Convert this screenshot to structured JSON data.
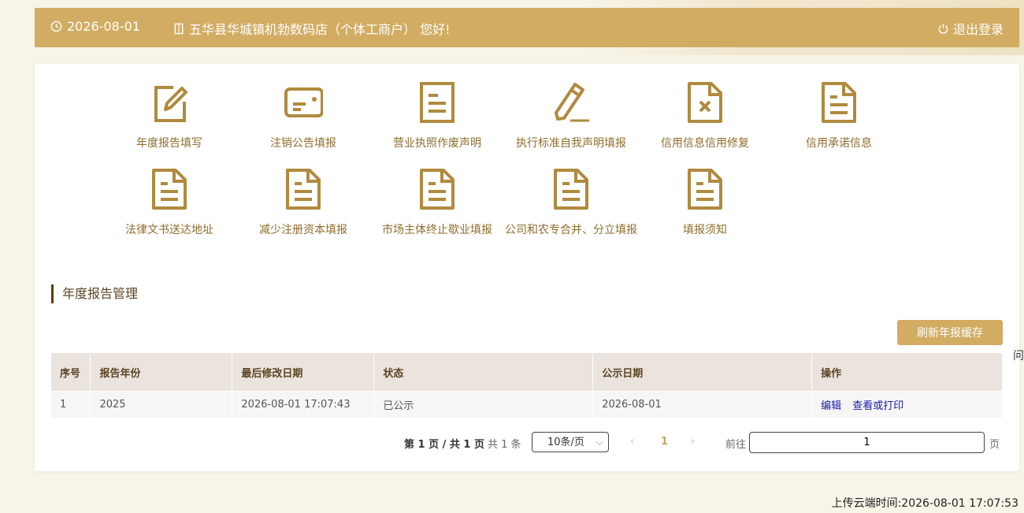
{
  "topbar": {
    "date": "2026-08-01",
    "greeting": "五华县华城镇机勃数码店（个体工商户） 您好!",
    "logout_label": "退出登录"
  },
  "menu": [
    {
      "label": "年度报告填写",
      "icon": "edit-icon"
    },
    {
      "label": "注销公告填报",
      "icon": "id-card-icon"
    },
    {
      "label": "营业执照作废声明",
      "icon": "document-icon"
    },
    {
      "label": "执行标准自我声明填报",
      "icon": "pen-icon"
    },
    {
      "label": "信用信息信用修复",
      "icon": "document-x-icon"
    },
    {
      "label": "信用承诺信息",
      "icon": "file-text-icon"
    },
    {
      "label": "法律文书送达地址",
      "icon": "file-text-icon"
    },
    {
      "label": "减少注册资本填报",
      "icon": "file-text-icon"
    },
    {
      "label": "市场主体终止歇业填报",
      "icon": "file-text-icon"
    },
    {
      "label": "公司和农专合并、分立填报",
      "icon": "file-text-icon"
    },
    {
      "label": "填报须知",
      "icon": "file-text-icon"
    }
  ],
  "section_title": "年度报告管理",
  "refresh_label": "刷新年报缓存",
  "table": {
    "headers": [
      "序号",
      "报告年份",
      "最后修改日期",
      "状态",
      "公示日期",
      "操作"
    ],
    "rows": [
      {
        "no": "1",
        "year": "2025",
        "modified": "2026-08-01 17:07:43",
        "status": "已公示",
        "public_date": "2026-08-01",
        "op_edit": "编辑",
        "op_view": "查看或打印"
      }
    ]
  },
  "pager": {
    "info": "第 1 页 / 共 1 页",
    "total": "共 1 条",
    "page_size": "10条/页",
    "prev": "‹",
    "current": "1",
    "next": "›",
    "goto_label": "前往",
    "goto_value": "1",
    "unit": "页"
  },
  "side_char": "问",
  "upload_time": "上传云端时间:2026-08-01 17:07:53",
  "colors": {
    "accent": "#d1ac62",
    "icon": "#b08a3e",
    "label": "#8f6d2c",
    "link": "#1a1aa6"
  }
}
